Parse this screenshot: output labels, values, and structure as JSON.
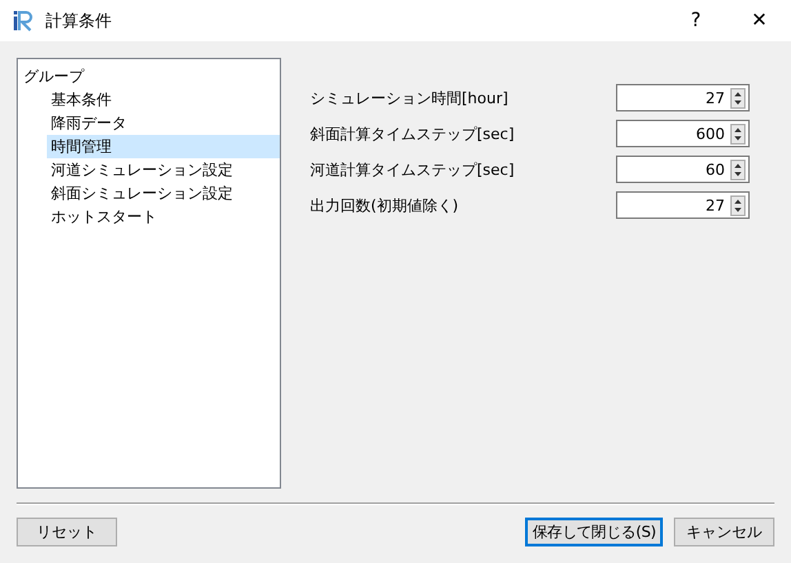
{
  "window": {
    "title": "計算条件",
    "help": "?",
    "close": "✕"
  },
  "tree": {
    "label": "グループ",
    "children": [
      {
        "label": "基本条件",
        "selected": false
      },
      {
        "label": "降雨データ",
        "selected": false
      },
      {
        "label": "時間管理",
        "selected": true
      },
      {
        "label": "河道シミュレーション設定",
        "selected": false
      },
      {
        "label": "斜面シミュレーション設定",
        "selected": false
      },
      {
        "label": "ホットスタート",
        "selected": false
      }
    ]
  },
  "fields": [
    {
      "label": "シミュレーション時間[hour]",
      "value": "27"
    },
    {
      "label": "斜面計算タイムステップ[sec]",
      "value": "600"
    },
    {
      "label": "河道計算タイムステップ[sec]",
      "value": "60"
    },
    {
      "label": "出力回数(初期値除く)",
      "value": "27"
    }
  ],
  "buttons": [
    {
      "label": "リセット",
      "kind": "plain"
    },
    {
      "label": "保存して閉じる(S)",
      "kind": "default"
    },
    {
      "label": "キャンセル",
      "kind": "plain"
    }
  ]
}
